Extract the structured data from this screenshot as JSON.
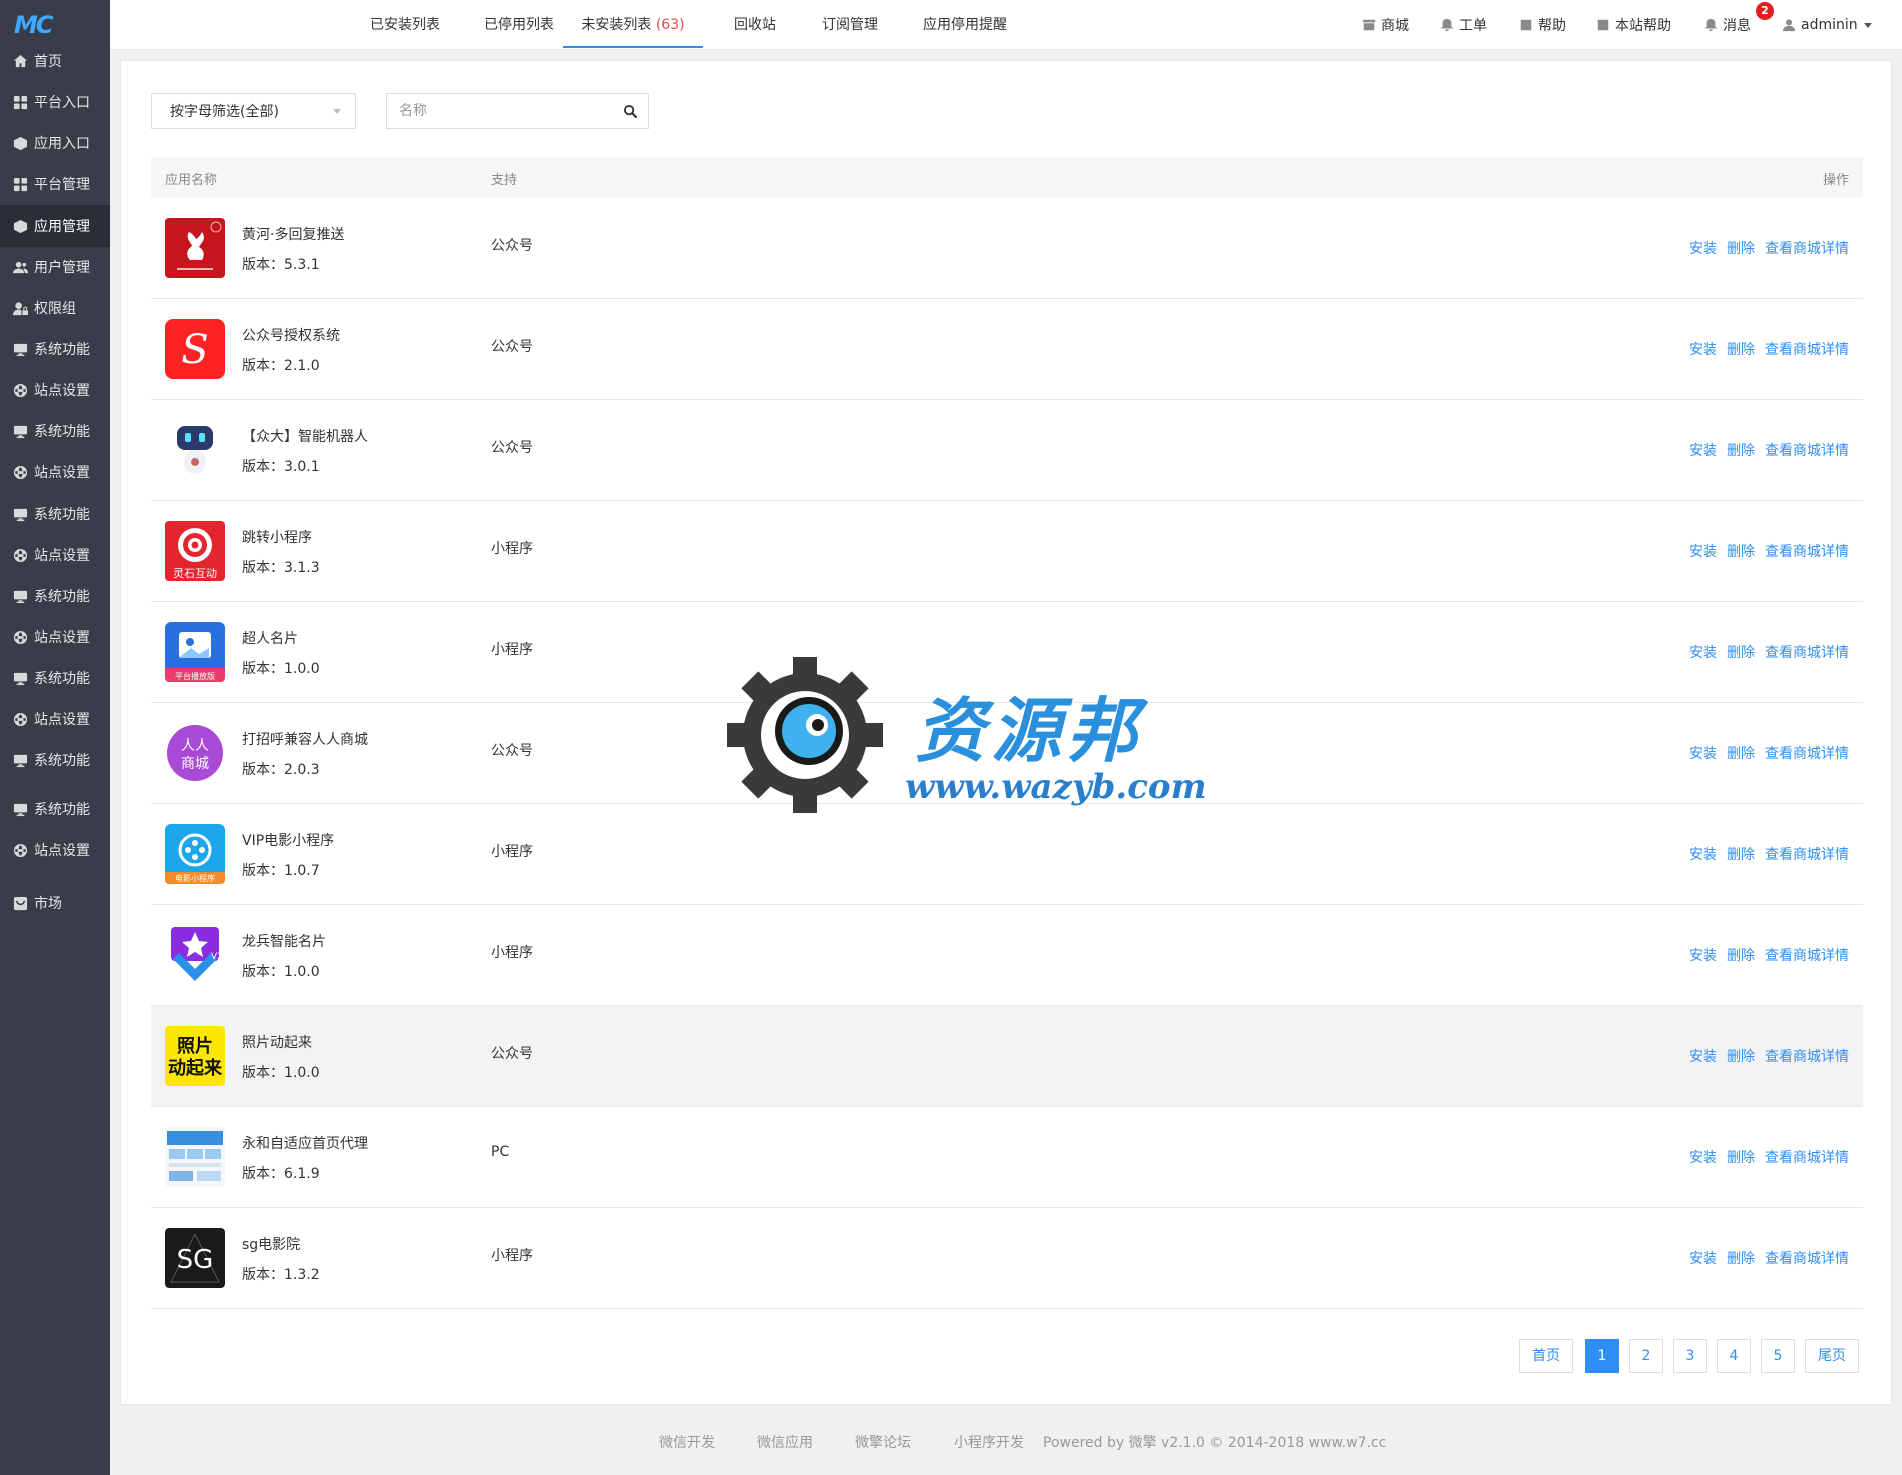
{
  "brand": {
    "logo": "MC"
  },
  "sidebar": {
    "items": [
      {
        "label": "首页",
        "icon": "home-icon"
      },
      {
        "label": "平台入口",
        "icon": "grid-icon"
      },
      {
        "label": "应用入口",
        "icon": "cube-icon"
      },
      {
        "label": "平台管理",
        "icon": "grid-icon"
      },
      {
        "label": "应用管理",
        "icon": "cube-icon"
      },
      {
        "label": "用户管理",
        "icon": "user-icon"
      },
      {
        "label": "权限组",
        "icon": "user-lock-icon"
      },
      {
        "label": "系统功能",
        "icon": "monitor-icon"
      },
      {
        "label": "站点设置",
        "icon": "globe-icon"
      },
      {
        "label": "系统功能",
        "icon": "monitor-icon"
      },
      {
        "label": "站点设置",
        "icon": "globe-icon"
      },
      {
        "label": "系统功能",
        "icon": "monitor-icon"
      },
      {
        "label": "站点设置",
        "icon": "globe-icon"
      },
      {
        "label": "系统功能",
        "icon": "monitor-icon"
      },
      {
        "label": "站点设置",
        "icon": "globe-icon"
      },
      {
        "label": "系统功能",
        "icon": "monitor-icon"
      },
      {
        "label": "站点设置",
        "icon": "globe-icon"
      },
      {
        "label": "系统功能",
        "icon": "monitor-icon"
      },
      {
        "label": "系统功能",
        "icon": "monitor-icon"
      },
      {
        "label": "站点设置",
        "icon": "globe-icon"
      },
      {
        "label": "市场",
        "icon": "shop-icon"
      }
    ],
    "active": "应用管理"
  },
  "tabs": [
    {
      "label": "已安装列表"
    },
    {
      "label": "已停用列表"
    },
    {
      "label": "未安装列表",
      "count": "(63)"
    },
    {
      "label": "回收站"
    },
    {
      "label": "订阅管理"
    },
    {
      "label": "应用停用提醒"
    }
  ],
  "toolbar": {
    "shop": "商城",
    "ticket": "工单",
    "help": "帮助",
    "site_help": "本站帮助",
    "messages": "消息",
    "message_count": "2",
    "user": "adminin"
  },
  "filter": {
    "letter_select": "按字母筛选(全部)",
    "search_placeholder": "名称"
  },
  "table": {
    "col_name": "应用名称",
    "col_support": "支持",
    "col_actions": "操作",
    "version_prefix": "版本：",
    "action_install": "安装",
    "action_delete": "删除",
    "action_detail": "查看商城详情",
    "rows": [
      {
        "name": "黄河·多回复推送",
        "version": "5.3.1",
        "support": "公众号",
        "icon": "playboy-logo"
      },
      {
        "name": "公众号授权系统",
        "version": "2.1.0",
        "support": "公众号",
        "icon": "s-logo"
      },
      {
        "name": "【众大】智能机器人",
        "version": "3.0.1",
        "support": "公众号",
        "icon": "robot-logo"
      },
      {
        "name": "跳转小程序",
        "version": "3.1.3",
        "support": "小程序",
        "icon": "target-logo",
        "icon_text": "灵石互动"
      },
      {
        "name": "超人名片",
        "version": "1.0.0",
        "support": "小程序",
        "icon": "card-logo",
        "icon_text": "平台播放版"
      },
      {
        "name": "打招呼兼容人人商城",
        "version": "2.0.3",
        "support": "公众号",
        "icon": "renren-logo",
        "icon_text": "人人商城"
      },
      {
        "name": "VIP电影小程序",
        "version": "1.0.7",
        "support": "小程序",
        "icon": "film-logo",
        "icon_text": "电影小程序"
      },
      {
        "name": "龙兵智能名片",
        "version": "1.0.0",
        "support": "小程序",
        "icon": "star-logo",
        "icon_text": "V2"
      },
      {
        "name": "照片动起来",
        "version": "1.0.0",
        "support": "公众号",
        "icon": "photo-logo",
        "icon_text": "照片动起来"
      },
      {
        "name": "永和自适应首页代理",
        "version": "6.1.9",
        "support": "PC",
        "icon": "website-logo"
      },
      {
        "name": "sg电影院",
        "version": "1.3.2",
        "support": "小程序",
        "icon": "sg-logo",
        "icon_text": "SG"
      }
    ]
  },
  "pagination": {
    "first": "首页",
    "pages": [
      "1",
      "2",
      "3",
      "4",
      "5"
    ],
    "current": "1",
    "last": "尾页"
  },
  "footer": {
    "links": [
      "微信开发",
      "微信应用",
      "微擎论坛",
      "小程序开发"
    ],
    "copyright": "Powered by 微擎 v2.1.0 © 2014-2018 www.w7.cc"
  },
  "watermark": {
    "title": "资源邦",
    "url": "www.wazyb.com"
  },
  "colors": {
    "sidebar": "#393d49",
    "accent": "#2f8ef4",
    "badge": "#e02020"
  }
}
